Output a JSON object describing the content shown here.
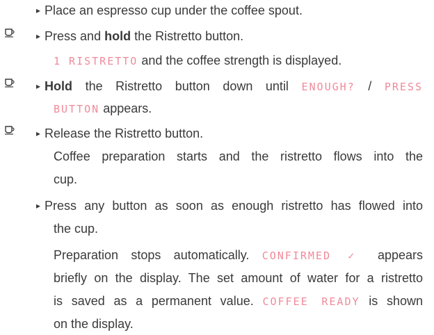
{
  "steps": {
    "s1": "Place an espresso cup under the coffee spout.",
    "s2_pre": "Press and ",
    "s2_bold": "hold",
    "s2_post": " the Ristretto button.",
    "s2_lcd": "1 RISTRETTO",
    "s2_desc": " and the coffee strength is displayed.",
    "s3_bold": "Hold",
    "s3_mid": " the Ristretto button down until ",
    "s3_lcd1": "ENOUGH?",
    "s3_sep": " / ",
    "s3_lcd2a": "PRESS",
    "s3_lcd2b": "BUTTON",
    "s3_tail": " appears.",
    "s4": "Release the Ristretto button.",
    "s4_desc1": "Coffee preparation starts and the ristretto flows into the",
    "s4_desc2": "cup.",
    "s5a": "Press any button as soon as enough ristretto has flowed into",
    "s5b": "the cup.",
    "p1_pre": "Preparation stops automatically. ",
    "p1_lcd": "CONFIRMED ✓",
    "p1_post": " appears",
    "p2": "briefly on the display. The set amount of water for a ristretto",
    "p3_pre": "is saved as a permanent value. ",
    "p3_lcd": "COFFEE READY",
    "p3_post": " is shown",
    "p4": "on the display."
  },
  "icons": {
    "arrow": "▸",
    "cup": "coffee-cup-icon"
  },
  "colors": {
    "text": "#3a3a3a",
    "lcd": "#f08a9a"
  }
}
